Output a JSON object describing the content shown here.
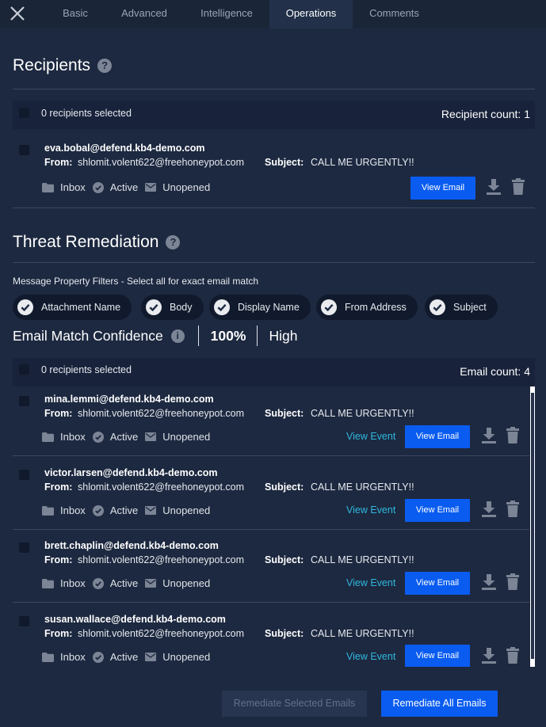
{
  "tabs": [
    {
      "label": "Basic",
      "active": false
    },
    {
      "label": "Advanced",
      "active": false
    },
    {
      "label": "Intelligence",
      "active": false
    },
    {
      "label": "Operations",
      "active": true
    },
    {
      "label": "Comments",
      "active": false
    }
  ],
  "recipients_section": {
    "title": "Recipients",
    "help": "?",
    "selected_text": "0 recipients selected",
    "count_text": "Recipient count: 1",
    "rows": [
      {
        "recipient": "eva.bobal@defend.kb4-demo.com",
        "from_label": "From:",
        "from": "shlomit.volent622@freehoneypot.com",
        "subject_label": "Subject:",
        "subject": "CALL ME URGENTLY!!",
        "folder": "Inbox",
        "state": "Active",
        "read_status": "Unopened",
        "view_email_label": "View Email"
      }
    ]
  },
  "threat_section": {
    "title": "Threat Remediation",
    "help": "?",
    "filter_label": "Message Property Filters - Select all for exact email match",
    "filters": [
      "Attachment Name",
      "Body",
      "Display Name",
      "From Address",
      "Subject"
    ],
    "confidence_label": "Email Match Confidence",
    "confidence_info": "i",
    "confidence_pct": "100%",
    "confidence_level": "High",
    "selected_text": "0 recipients selected",
    "count_text": "Email count: 4",
    "rows": [
      {
        "recipient": "mina.lemmi@defend.kb4-demo.com",
        "from_label": "From:",
        "from": "shlomit.volent622@freehoneypot.com",
        "subject_label": "Subject:",
        "subject": "CALL ME URGENTLY!!",
        "folder": "Inbox",
        "state": "Active",
        "read_status": "Unopened",
        "view_event_label": "View Event",
        "view_email_label": "View Email"
      },
      {
        "recipient": "victor.larsen@defend.kb4-demo.com",
        "from_label": "From:",
        "from": "shlomit.volent622@freehoneypot.com",
        "subject_label": "Subject:",
        "subject": "CALL ME URGENTLY!!",
        "folder": "Inbox",
        "state": "Active",
        "read_status": "Unopened",
        "view_event_label": "View Event",
        "view_email_label": "View Email"
      },
      {
        "recipient": "brett.chaplin@defend.kb4-demo.com",
        "from_label": "From:",
        "from": "shlomit.volent622@freehoneypot.com",
        "subject_label": "Subject:",
        "subject": "CALL ME URGENTLY!!",
        "folder": "Inbox",
        "state": "Active",
        "read_status": "Unopened",
        "view_event_label": "View Event",
        "view_email_label": "View Email"
      },
      {
        "recipient": "susan.wallace@defend.kb4-demo.com",
        "from_label": "From:",
        "from": "shlomit.volent622@freehoneypot.com",
        "subject_label": "Subject:",
        "subject": "CALL ME URGENTLY!!",
        "folder": "Inbox",
        "state": "Active",
        "read_status": "Unopened",
        "view_event_label": "View Event",
        "view_email_label": "View Email"
      }
    ]
  },
  "actions": {
    "remediate_selected_label": "Remediate Selected Emails",
    "remediate_all_label": "Remediate All Emails"
  },
  "icons": {
    "close": "close-icon",
    "folder": "folder-icon",
    "status": "check-circle-icon",
    "mail": "envelope-icon",
    "download": "download-icon",
    "delete": "trash-icon",
    "filter_check": "check-circle-icon"
  },
  "colors": {
    "background": "#1d2940",
    "topbar": "#1a2538",
    "active_tab": "#223049",
    "primary": "#0a5cf0",
    "link": "#2fb8de",
    "muted_icon": "#7c8596"
  }
}
